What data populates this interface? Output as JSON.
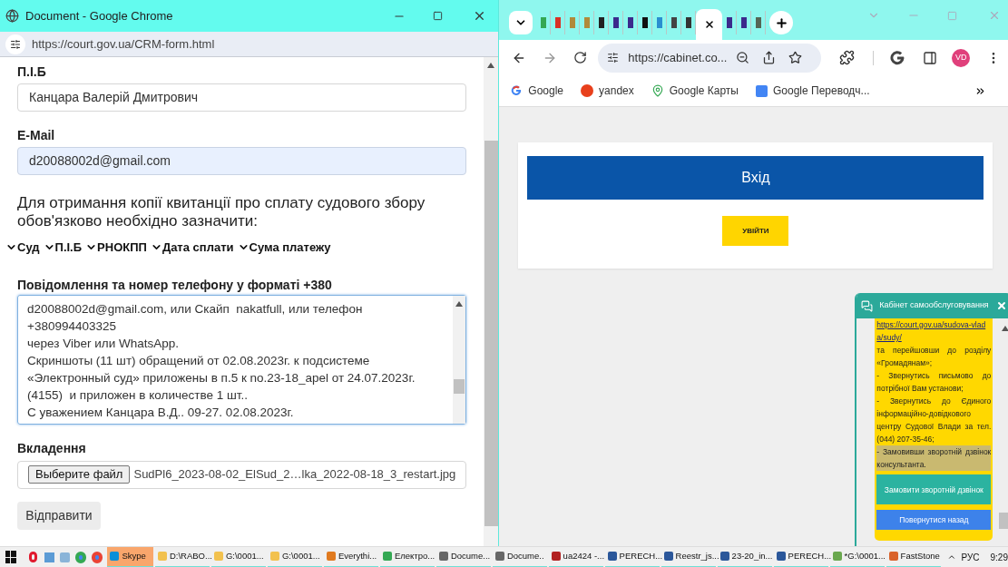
{
  "left_window": {
    "title": "Document - Google Chrome",
    "url": "https://court.gov.ua/CRM-form.html",
    "fields": [
      {
        "label": "П.І.Б",
        "value": "Канцара Валерій Дмитрович",
        "autofilled": false
      },
      {
        "label": "E-Mail",
        "value": "d20088002d@gmail.com",
        "autofilled": true
      }
    ],
    "notice": "Для отримання копії квитанції про сплату судового збору обов'язково необхідно зазначити:",
    "toggles": [
      {
        "label": "Суд",
        "expanded": false
      },
      {
        "label": "П.І.Б",
        "expanded": false
      },
      {
        "label": "РНОКПП",
        "expanded": false
      },
      {
        "label": "Дата сплати",
        "expanded": false
      },
      {
        "label": "Сума платежу",
        "expanded": false
      }
    ],
    "message": {
      "label": "Повідомлення та номер телефону у форматі +380",
      "focused": true,
      "lines": [
        "d20088002d@gmail.com, или Скайп  nakatfull, или телефон +380994403325",
        "через Viber или WhatsApp.",
        "Скриншоты (11 шт) обращений от 02.08.2023г. к подсистеме «Электронный суд» приложены в п.5 к no.23-18_apel от 24.07.2023г. (4155)  и приложен в количестве 1 шт..",
        "С уважением Канцара В.Д.. 09-27. 02.08.2023г."
      ]
    },
    "attachment": {
      "label": "Вкладення",
      "button": "Выберите файл",
      "file_name": "SudPl6_2023-08-02_ElSud_2…lka_2022-08-18_3_restart.jpg"
    },
    "submit": "Відправити"
  },
  "right_window": {
    "tabs": [
      {
        "selected": false
      },
      {
        "selected": false
      },
      {
        "selected": false
      },
      {
        "selected": false
      },
      {
        "selected": false
      },
      {
        "selected": false
      },
      {
        "selected": false
      },
      {
        "selected": false
      },
      {
        "selected": false
      },
      {
        "selected": false
      },
      {
        "selected": false
      },
      {
        "selected": true
      },
      {
        "selected": false
      },
      {
        "selected": false
      },
      {
        "selected": false
      }
    ],
    "url": "https://cabinet.co...",
    "profile_initials": "VD",
    "bookmarks": [
      "Google",
      "yandex",
      "Google Карты",
      "Google Переводч..."
    ],
    "heading": "Вхід",
    "login_button": "УВІЙТИ",
    "chat": {
      "title": "Кабінет самообслуговування",
      "items": [
        {
          "link": "https://court.gov.ua/sudova-vlada/sudy/",
          "text": " та перейшовши до розділу «Громадянам»;",
          "highlighted": false
        },
        {
          "text": "- Звернутись письмово до потрібної Вам установи;",
          "highlighted": false
        },
        {
          "text": "- Звернутись до Єдиного інформаційно-довідкового центру Судової Влади за тел. (044) 207-35-46;",
          "highlighted": false
        },
        {
          "text": "- Замовивши зворотній дзвінок консультанта.",
          "highlighted": true
        }
      ],
      "buttons": [
        {
          "label": "Замовити зворотній дзвінок",
          "kind": "secondary"
        },
        {
          "label": "Повернутися назад",
          "kind": "primary"
        }
      ]
    }
  },
  "taskbar": {
    "tasks": [
      {
        "label": "Skype",
        "selected": true,
        "running": true
      },
      {
        "label": "D:\\RABO...",
        "selected": false,
        "running": true
      },
      {
        "label": "G:\\0001...",
        "selected": false,
        "running": true
      },
      {
        "label": "G:\\0001...",
        "selected": false,
        "running": true
      },
      {
        "label": "Everythi...",
        "selected": false,
        "running": true
      },
      {
        "label": "Електро...",
        "selected": false,
        "running": true
      },
      {
        "label": "Docume...",
        "selected": false,
        "running": true
      },
      {
        "label": "Docume..",
        "selected": false,
        "running": true
      },
      {
        "label": "ua2424 -...",
        "selected": false,
        "running": true
      },
      {
        "label": "PERECH...",
        "selected": false,
        "running": true
      },
      {
        "label": "Reestr_js...",
        "selected": false,
        "running": true
      },
      {
        "label": "23-20_in...",
        "selected": false,
        "running": true
      },
      {
        "label": "PERECH...",
        "selected": false,
        "running": true
      },
      {
        "label": "*G:\\0001...",
        "selected": false,
        "running": true
      },
      {
        "label": "FastStone",
        "selected": false,
        "running": true
      }
    ],
    "language": "РУС",
    "time": "9:29"
  }
}
